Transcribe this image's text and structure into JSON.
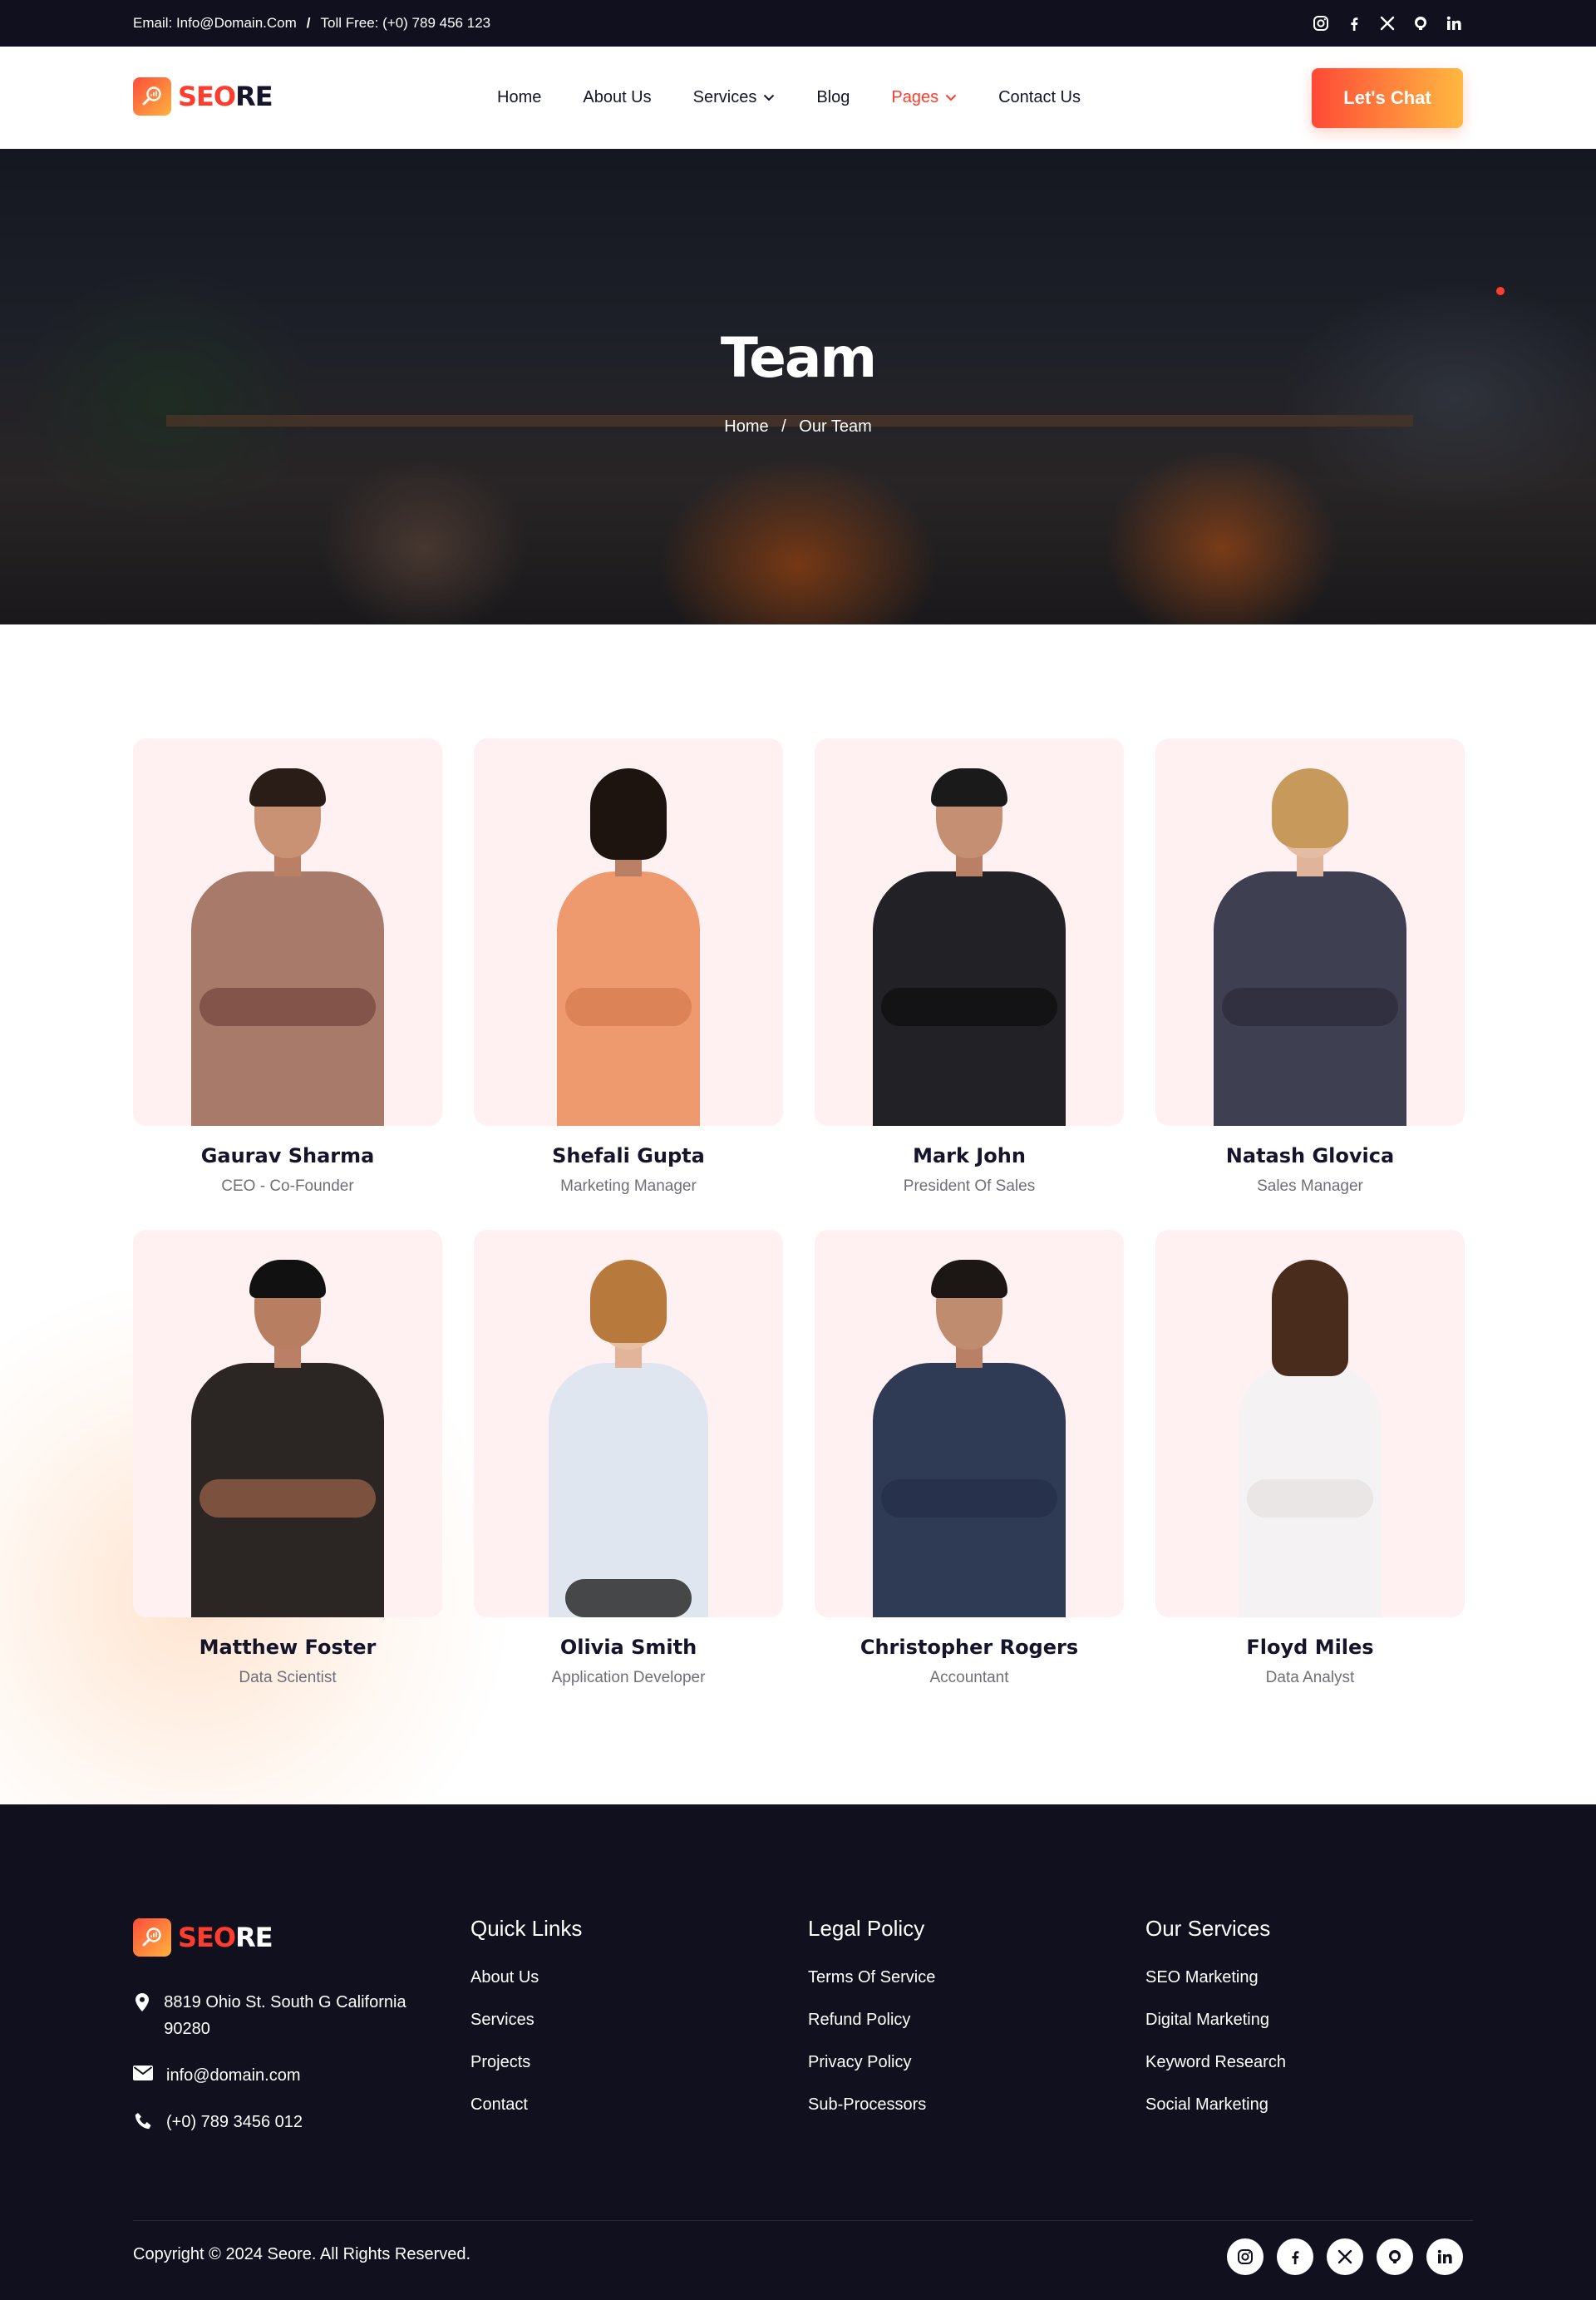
{
  "topbar": {
    "email_text": "Email: Info@Domain.Com",
    "separator": "/",
    "phone_text": "Toll Free: (+0) 789 456 123",
    "socials": [
      "instagram-icon",
      "facebook-icon",
      "x-twitter-icon",
      "github-icon",
      "linkedin-icon"
    ]
  },
  "brand": {
    "name_accent": "SEO",
    "name_rest": "RE"
  },
  "nav": {
    "items": [
      {
        "label": "Home"
      },
      {
        "label": "About Us"
      },
      {
        "label": "Services",
        "has_dropdown": true
      },
      {
        "label": "Blog"
      },
      {
        "label": "Pages",
        "has_dropdown": true,
        "active": true
      },
      {
        "label": "Contact Us"
      }
    ],
    "cta_label": "Let's Chat"
  },
  "hero": {
    "title": "Team",
    "breadcrumb": {
      "home": "Home",
      "separator": "/",
      "current": "Our Team"
    }
  },
  "team": {
    "members": [
      {
        "name": "Gaurav Sharma",
        "role": "CEO - Co-Founder"
      },
      {
        "name": "Shefali Gupta",
        "role": "Marketing Manager"
      },
      {
        "name": "Mark John",
        "role": "President Of Sales"
      },
      {
        "name": "Natash Glovica",
        "role": "Sales Manager"
      },
      {
        "name": "Matthew Foster",
        "role": "Data Scientist"
      },
      {
        "name": "Olivia Smith",
        "role": "Application Developer"
      },
      {
        "name": "Christopher Rogers",
        "role": "Accountant"
      },
      {
        "name": "Floyd Miles",
        "role": "Data Analyst"
      }
    ]
  },
  "footer": {
    "address": "8819 Ohio St. South G California 90280",
    "email": "info@domain.com",
    "phone": "(+0) 789 3456 012",
    "quick_links": {
      "title": "Quick Links",
      "items": [
        "About Us",
        "Services",
        "Projects",
        "Contact"
      ]
    },
    "legal_policy": {
      "title": "Legal Policy",
      "items": [
        "Terms Of Service",
        "Refund Policy",
        "Privacy Policy",
        "Sub-Processors"
      ]
    },
    "our_services": {
      "title": "Our Services",
      "items": [
        "SEO Marketing",
        "Digital Marketing",
        "Keyword Research",
        "Social Marketing"
      ]
    },
    "copyright": "Copyright © 2024 Seore. All Rights Reserved.",
    "socials": [
      "instagram-icon",
      "facebook-icon",
      "x-twitter-icon",
      "github-icon",
      "linkedin-icon"
    ]
  },
  "colors": {
    "accent": "#ff3d2e",
    "accent_gradient_end": "#ffb840",
    "dark": "#10101f",
    "card_bg": "#fff1f1"
  }
}
